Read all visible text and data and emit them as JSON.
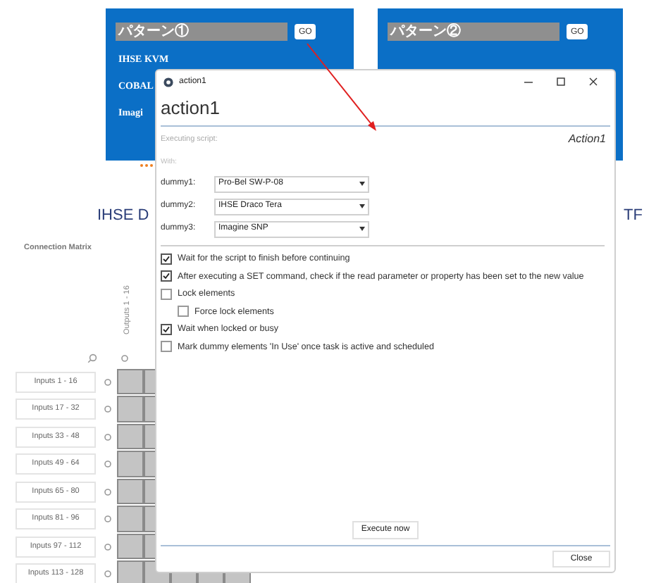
{
  "patterns": [
    {
      "name": "パターン①",
      "button": "GO",
      "rows": [
        "IHSE KVM",
        "COBAL",
        "Imagi"
      ]
    },
    {
      "name": "パターン②",
      "button": "GO"
    }
  ],
  "heading": "IHSE D",
  "heading_right": "TF",
  "matrix": {
    "title": "Connection Matrix",
    "output_group": "Outputs 1 - 16",
    "input_groups": [
      "Inputs 1 - 16",
      "Inputs 17 - 32",
      "Inputs 33 - 48",
      "Inputs 49 - 64",
      "Inputs 65 - 80",
      "Inputs 81 - 96",
      "Inputs 97 - 112",
      "Inputs 113 - 128"
    ]
  },
  "dialog": {
    "title": "action1",
    "heading": "action1",
    "script_label": "Executing script:",
    "script_name": "Action1",
    "with_label": "With:",
    "params": [
      {
        "label": "dummy1:",
        "value": "Pro-Bel SW-P-08"
      },
      {
        "label": "dummy2:",
        "value": "IHSE Draco Tera"
      },
      {
        "label": "dummy3:",
        "value": "Imagine SNP"
      }
    ],
    "options": [
      {
        "label": "Wait for the script to finish before continuing",
        "checked": true
      },
      {
        "label": "After executing a SET command, check if the read parameter or property has been set to the new value",
        "checked": true
      },
      {
        "label": "Lock elements",
        "checked": false,
        "children": [
          {
            "label": "Force lock elements",
            "checked": false
          }
        ]
      },
      {
        "label": "Wait when locked or busy",
        "checked": true
      },
      {
        "label": "Mark dummy elements 'In Use' once task is active and scheduled",
        "checked": false
      }
    ],
    "execute_button": "Execute now",
    "close_button": "Close"
  }
}
